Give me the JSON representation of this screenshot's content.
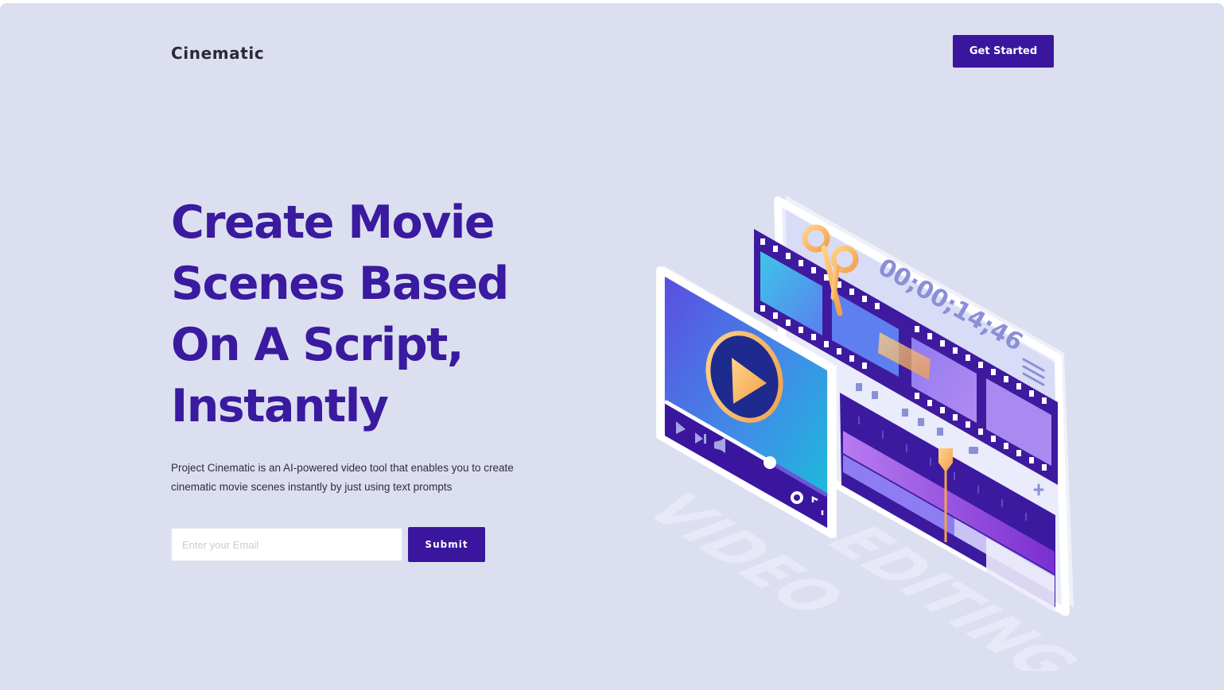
{
  "header": {
    "brand": "Cinematic",
    "cta_label": "Get Started"
  },
  "hero": {
    "title_lines": [
      "Create Movie",
      "Scenes Based",
      "On A Script,",
      "Instantly"
    ],
    "description_line1": "Project Cinematic is an AI-powered video tool that enables you to create",
    "description_line2": "cinematic movie scenes instantly by just using text prompts"
  },
  "signup": {
    "email_placeholder": "Enter your Email",
    "submit_label": "Submit"
  },
  "illustration": {
    "timecode": "00;00;14;46",
    "word_left": "VIDEO",
    "word_right": "EDITING"
  },
  "colors": {
    "background": "#dcdff0",
    "accent": "#3a169e",
    "title": "#3a1a9e"
  }
}
